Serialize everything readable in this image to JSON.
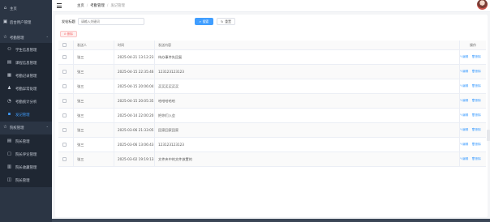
{
  "sidebar": {
    "items": [
      {
        "icon": "home-icon",
        "glyph": "⌂",
        "label": "主页"
      },
      {
        "icon": "admin-icon",
        "glyph": "▣",
        "label": "后台用户管理"
      },
      {
        "icon": "star-icon",
        "glyph": "☆",
        "label": "考勤管理",
        "expanded": true
      },
      {
        "icon": "user-icon",
        "glyph": "⚇",
        "label": "学生信息管理",
        "sub": true
      },
      {
        "icon": "course-icon",
        "glyph": "▤",
        "label": "课程信息管理",
        "sub": true
      },
      {
        "icon": "record-icon",
        "glyph": "▦",
        "label": "考勤记录管理",
        "sub": true
      },
      {
        "icon": "person-icon",
        "glyph": "♟",
        "label": "考勤异常处理",
        "sub": true
      },
      {
        "icon": "stats-icon",
        "glyph": "◔",
        "label": "考勤统计分析",
        "sub": true
      },
      {
        "icon": "message-icon",
        "glyph": "▪",
        "label": "发记管理",
        "sub": true,
        "active": true
      },
      {
        "icon": "star-icon",
        "glyph": "☆",
        "label": "院校管理",
        "expanded": true
      },
      {
        "icon": "doc-icon",
        "glyph": "▤",
        "label": "院长管理",
        "sub": true
      },
      {
        "icon": "comment-icon",
        "glyph": "▢",
        "label": "院长评论管理",
        "sub": true
      },
      {
        "icon": "favorite-icon",
        "glyph": "▥",
        "label": "院长收藏管理",
        "sub": true
      },
      {
        "icon": "report-icon",
        "glyph": "◫",
        "label": "院长管理",
        "sub": true
      }
    ]
  },
  "header": {
    "breadcrumbs": [
      "主页",
      "考勤管理",
      "发记管理"
    ]
  },
  "search": {
    "label": "发帖标题",
    "placeholder": "请输入关键词",
    "search_button": "搜索",
    "reset_button": "重置"
  },
  "toolbar": {
    "delete_button": "删除"
  },
  "table": {
    "columns": [
      "发送人",
      "时间",
      "发送内容",
      "操作"
    ],
    "edit_label": "编辑",
    "delete_label": "删除",
    "rows": [
      {
        "who": "张三",
        "time": "2025-04-21 13:12:23",
        "content": "待办事件先回复"
      },
      {
        "who": "张三",
        "time": "2025-04-15 22:35:46",
        "content": "123123123123"
      },
      {
        "who": "张三",
        "time": "2025-04-15 20:06:04",
        "content": "买买买买买买"
      },
      {
        "who": "张三",
        "time": "2025-04-15 20:05:35",
        "content": "哈哈哈哈哈"
      },
      {
        "who": "张三",
        "time": "2025-04-14 22:00:20",
        "content": "把你们入会"
      },
      {
        "who": "张三",
        "time": "2025-03-06 21:33:05",
        "content": "回家回家回家"
      },
      {
        "who": "张三",
        "time": "2025-03-06 13:06:43",
        "content": "123123123123"
      },
      {
        "who": "张三",
        "time": "2025-03-02 19:19:13",
        "content": "文件夹中的文件放置的"
      }
    ]
  }
}
